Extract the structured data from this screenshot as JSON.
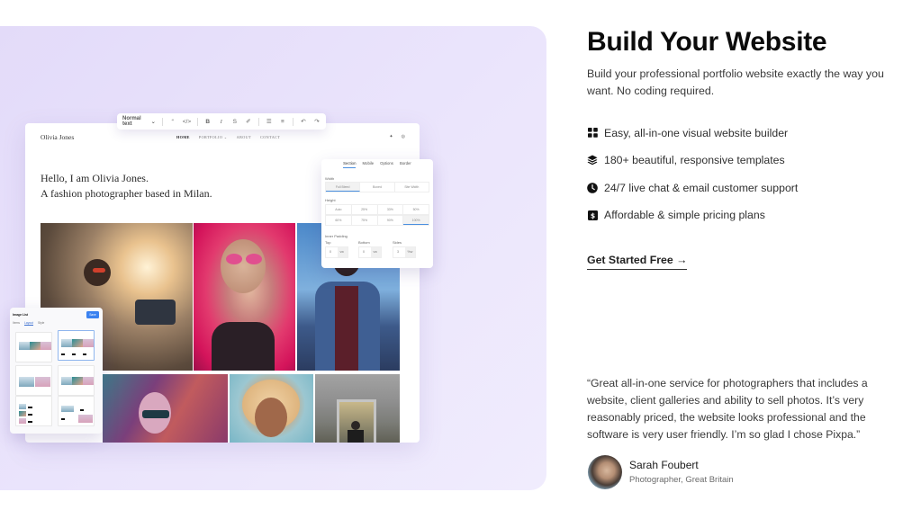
{
  "preview": {
    "toolbar": {
      "text_style": "Normal text",
      "items": [
        {
          "icon": "quote-icon",
          "glyph": "“"
        },
        {
          "icon": "code-icon",
          "glyph": "</>"
        },
        {
          "icon": "bold-icon",
          "glyph": "B"
        },
        {
          "icon": "italic-icon",
          "glyph": "I"
        },
        {
          "icon": "strikethrough-icon",
          "glyph": "S"
        },
        {
          "icon": "link-icon",
          "glyph": "✐"
        },
        {
          "icon": "bullet-list-icon",
          "glyph": "☰"
        },
        {
          "icon": "numbered-list-icon",
          "glyph": "≡"
        },
        {
          "icon": "undo-icon",
          "glyph": "↶"
        },
        {
          "icon": "redo-icon",
          "glyph": "↷"
        }
      ]
    },
    "site": {
      "logo": "Olivia Jones",
      "menu": [
        "HOME",
        "PORTFOLIO ⌄",
        "ABOUT",
        "CONTACT"
      ],
      "social": [
        {
          "icon": "twitter-icon",
          "glyph": "✦"
        },
        {
          "icon": "instagram-icon",
          "glyph": "◎"
        }
      ],
      "heading_line1": "Hello, I am Olivia Jones.",
      "heading_line2": "A fashion photographer based in Milan."
    },
    "settings_panel": {
      "tabs": [
        "Section",
        "Mobile",
        "Options",
        "Border"
      ],
      "active_tab": "Section",
      "width_label": "Width",
      "width_options": [
        "Full Bleed",
        "Boxed",
        "Site Width"
      ],
      "width_selected": "Full Bleed",
      "height_label": "Height",
      "height_options": [
        "Auto",
        "25%",
        "33%",
        "50%",
        "60%",
        "75%",
        "90%",
        "100%"
      ],
      "height_selected": "100%",
      "padding_label": "Inner Padding",
      "padding_fields": [
        {
          "label": "Top",
          "value": "0",
          "unit": "vw"
        },
        {
          "label": "Bottom",
          "value": "0",
          "unit": "vw"
        },
        {
          "label": "Sides",
          "value": "3",
          "unit": "%w"
        }
      ]
    },
    "image_list_panel": {
      "title": "Image List",
      "save_label": "Save",
      "tabs": [
        "Items",
        "Layout",
        "Style"
      ],
      "active_tab": "Layout"
    }
  },
  "content": {
    "title": "Build Your Website",
    "subtitle": "Build your professional portfolio website exactly the way you want. No coding required.",
    "features": [
      {
        "icon": "grid-icon",
        "text": "Easy, all-in-one visual website builder"
      },
      {
        "icon": "layers-icon",
        "text": "180+ beautiful, responsive templates"
      },
      {
        "icon": "clock-icon",
        "text": "24/7 live chat & email customer support"
      },
      {
        "icon": "dollar-icon",
        "text": "Affordable & simple pricing plans"
      }
    ],
    "cta_label": "Get Started Free →",
    "testimonial": {
      "quote": "“Great all-in-one service for photographers that includes a website, client galleries and ability to sell photos. It’s very reasonably priced, the website looks professional and the software is very user friendly. I’m so glad I chose Pixpa.”",
      "author": "Sarah Foubert",
      "role": "Photographer, Great Britain"
    }
  },
  "colors": {
    "panel_bg": "#e7e0fb",
    "accent_blue": "#3b82f0",
    "text_dark": "#0b0b0b"
  }
}
